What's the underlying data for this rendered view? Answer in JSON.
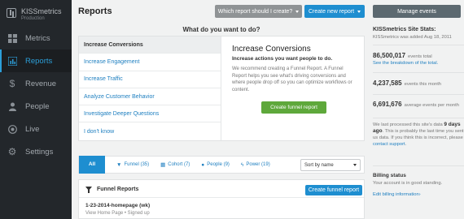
{
  "brand": {
    "name": "KISSmetrics",
    "subtitle": "Production"
  },
  "sidebar": {
    "items": [
      {
        "label": "Metrics",
        "icon": "dashboard-icon"
      },
      {
        "label": "Reports",
        "icon": "bar-chart-icon",
        "active": true
      },
      {
        "label": "Revenue",
        "icon": "dollar-icon"
      },
      {
        "label": "People",
        "icon": "person-icon"
      },
      {
        "label": "Live",
        "icon": "live-icon"
      },
      {
        "label": "Settings",
        "icon": "gear-icon"
      }
    ]
  },
  "header": {
    "title": "Reports",
    "which_report_label": "Which report should I create?",
    "create_new_label": "Create new report",
    "manage_events_label": "Manage events"
  },
  "questions": {
    "heading": "What do you want to do?",
    "items": [
      "Increase Conversions",
      "Increase Engagement",
      "Increase Traffic",
      "Analyze Customer Behavior",
      "Investigate Deeper Questions",
      "I don't know"
    ],
    "selected_index": 0,
    "detail": {
      "title": "Increase Conversions",
      "subtitle": "Increase actions you want people to do.",
      "description": "We recommend creating a Funnel Report. A Funnel Report helps you see what's driving conversions and where people drop off so you can optimize workflows or content.",
      "button_label": "Create funnel report"
    }
  },
  "filters": {
    "all_label": "All",
    "tabs": [
      {
        "label": "Funnel (35)",
        "icon": "funnel-icon"
      },
      {
        "label": "Cohort (7)",
        "icon": "cohort-grid-icon"
      },
      {
        "label": "People (9)",
        "icon": "people-icon"
      },
      {
        "label": "Power (19)",
        "icon": "power-icon"
      }
    ],
    "sort_value": "Sort by name"
  },
  "funnel_reports": {
    "title": "Funnel Reports",
    "button_label": "Create funnel report",
    "row": {
      "name": "1-23-2014-homepage (wk)",
      "steps": "View Home Page • Signed up"
    }
  },
  "stats": {
    "title": "KISSmetrics Site Stats:",
    "subtitle": "KISSmetrics was added Aug 18, 2011",
    "events_total": "86,500,017",
    "events_total_label": "events total",
    "events_total_link": "See the breakdown of the total.",
    "events_month": "4,237,585",
    "events_month_label": "events this month",
    "avg_events": "6,691,676",
    "avg_events_label": "average events per month",
    "processed_prefix": "We last processed this site's data",
    "processed_ago": "9 days ago",
    "processed_suffix": ". This is probably the last time you sent us data. If you think this is incorrect, please",
    "contact_link": "contact support",
    "billing_title": "Billing status",
    "billing_text": "Your account is in good standing.",
    "billing_link": "Edit billing information›"
  },
  "colors": {
    "sidebar_bg": "#23272b",
    "accent_blue": "#1e8ed0",
    "green": "#5ea83b",
    "link": "#1e7fc0"
  }
}
